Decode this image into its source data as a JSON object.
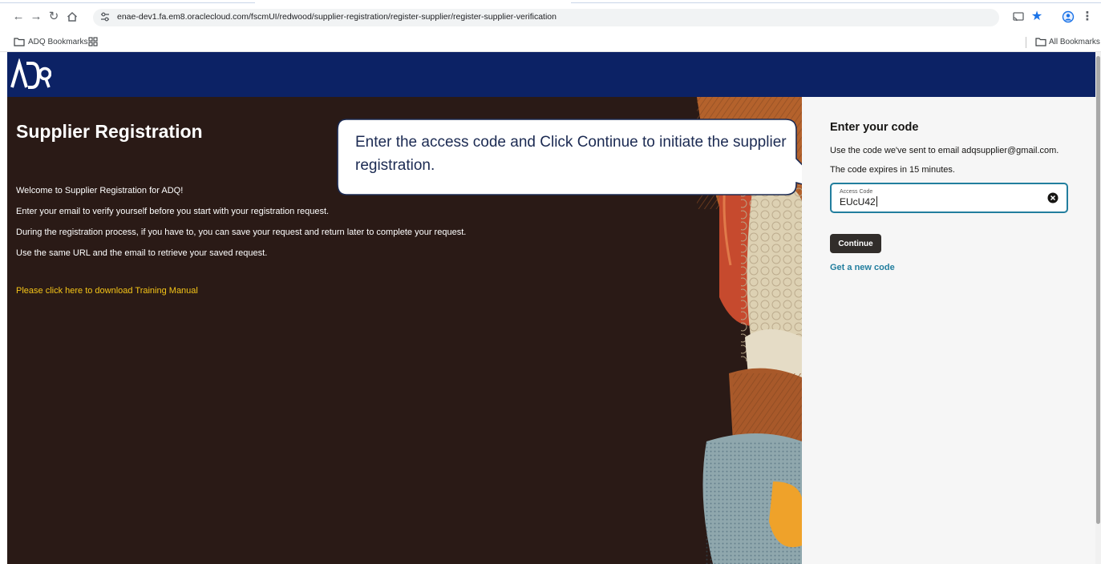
{
  "browser": {
    "url": "enae-dev1.fa.em8.oraclecloud.com/fscmUI/redwood/supplier-registration/register-supplier/register-supplier-verification",
    "bookmarks": {
      "folder_label": "ADQ Bookmarks",
      "all_bookmarks_label": "All Bookmarks"
    },
    "icons": [
      "back-icon",
      "forward-icon",
      "reload-icon",
      "home-icon",
      "site-settings-icon",
      "cast-icon",
      "bookmark-star-icon",
      "profile-icon",
      "menu-icon",
      "apps-grid-icon",
      "folder-icon"
    ],
    "accent_color": "#1a73e8"
  },
  "header": {
    "logo_text": "ADQ",
    "color": "#0c2265"
  },
  "hero": {
    "title": "Supplier Registration",
    "lines": [
      "Welcome to Supplier Registration for ADQ!",
      "Enter your email to verify yourself before you start with your registration request.",
      "During the registration process, if you have to, you can save your request and return later to complete your request.",
      "Use the same URL and the email to retrieve your saved request."
    ],
    "manual_link": "Please click here to download Training Manual"
  },
  "callout": {
    "text": "Enter the access code and Click Continue to initiate the supplier registration."
  },
  "panel": {
    "title": "Enter your code",
    "line1": "Use the code we've sent to email adqsupplier@gmail.com.",
    "line2": "The code expires in 15 minutes.",
    "field_label": "Access Code",
    "field_value": "EUcU42",
    "continue_label": "Continue",
    "new_code_label": "Get a new code",
    "link_color": "#227e9e",
    "button_color": "#312d2a"
  }
}
